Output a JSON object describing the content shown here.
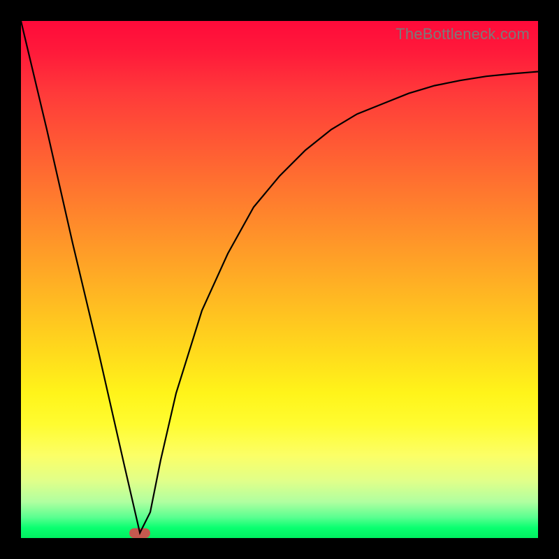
{
  "watermark": "TheBottleneck.com",
  "colors": {
    "marker": "#c5594f",
    "curve": "#000000"
  },
  "chart_data": {
    "type": "line",
    "title": "",
    "xlabel": "",
    "ylabel": "",
    "xlim": [
      0,
      100
    ],
    "ylim": [
      0,
      100
    ],
    "grid": false,
    "legend": false,
    "series": [
      {
        "name": "bottleneck-curve",
        "x": [
          0,
          5,
          10,
          15,
          20,
          23,
          25,
          27,
          30,
          35,
          40,
          45,
          50,
          55,
          60,
          65,
          70,
          75,
          80,
          85,
          90,
          95,
          100
        ],
        "y": [
          100,
          79,
          57,
          36,
          14,
          1,
          5,
          15,
          28,
          44,
          55,
          64,
          70,
          75,
          79,
          82,
          84,
          86,
          87.5,
          88.5,
          89.3,
          89.8,
          90.2
        ]
      }
    ],
    "marker": {
      "x": 23,
      "y": 1
    }
  }
}
